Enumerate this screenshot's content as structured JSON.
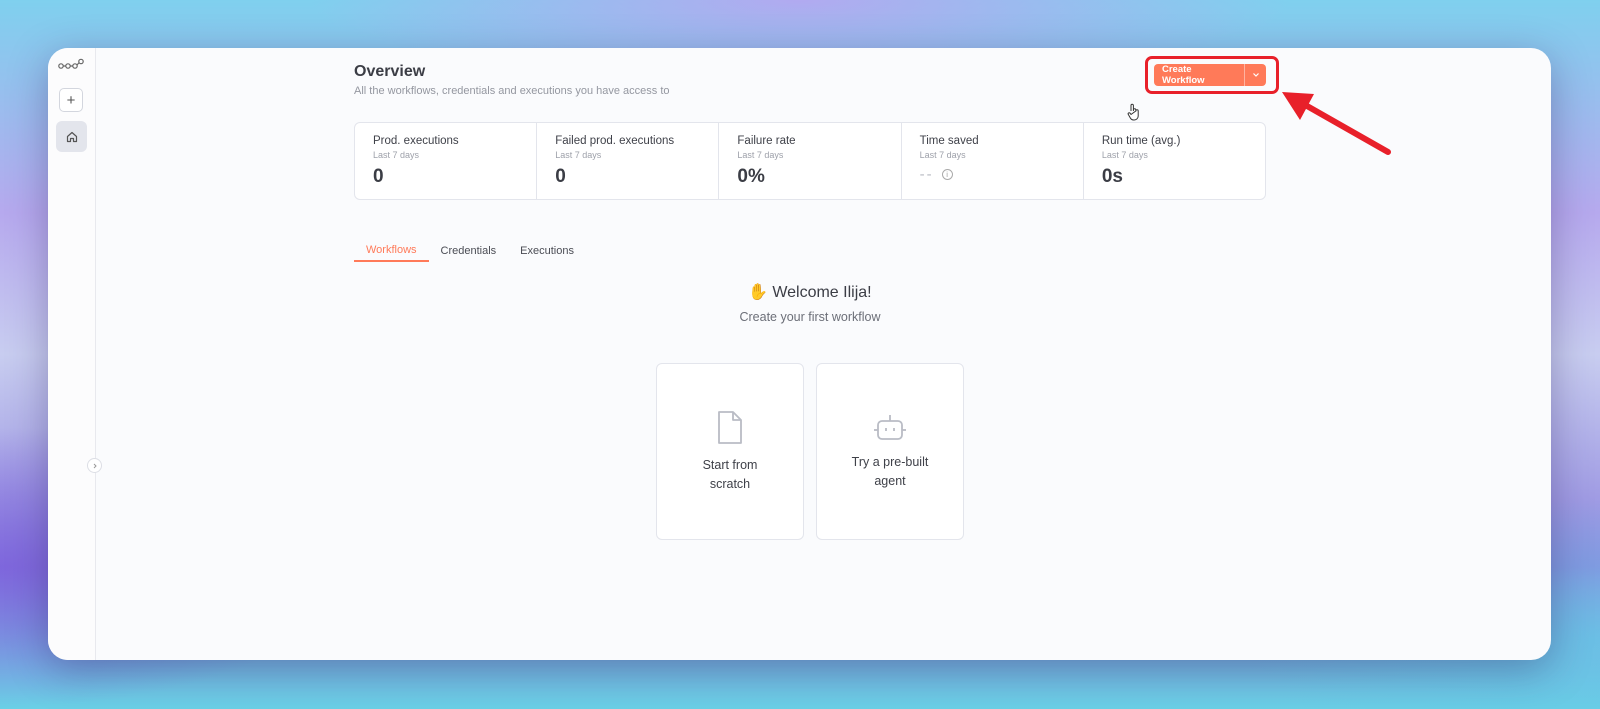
{
  "header": {
    "title": "Overview",
    "subtitle": "All the workflows, credentials and executions you have access to",
    "create_label": "Create Workflow"
  },
  "stats": [
    {
      "label": "Prod. executions",
      "period": "Last 7 days",
      "value": "0"
    },
    {
      "label": "Failed prod. executions",
      "period": "Last 7 days",
      "value": "0"
    },
    {
      "label": "Failure rate",
      "period": "Last 7 days",
      "value": "0%"
    },
    {
      "label": "Time saved",
      "period": "Last 7 days",
      "value": "--"
    },
    {
      "label": "Run time (avg.)",
      "period": "Last 7 days",
      "value": "0s"
    }
  ],
  "tabs": [
    {
      "label": "Workflows",
      "active": true
    },
    {
      "label": "Credentials",
      "active": false
    },
    {
      "label": "Executions",
      "active": false
    }
  ],
  "welcome": {
    "title": "Welcome Ilija!",
    "subtitle": "Create your first workflow"
  },
  "cards": [
    {
      "label": "Start from scratch",
      "icon": "file-icon"
    },
    {
      "label": "Try a pre-built agent",
      "icon": "robot-icon"
    }
  ],
  "colors": {
    "accent": "#ff7a59",
    "highlight": "#e8202a"
  }
}
